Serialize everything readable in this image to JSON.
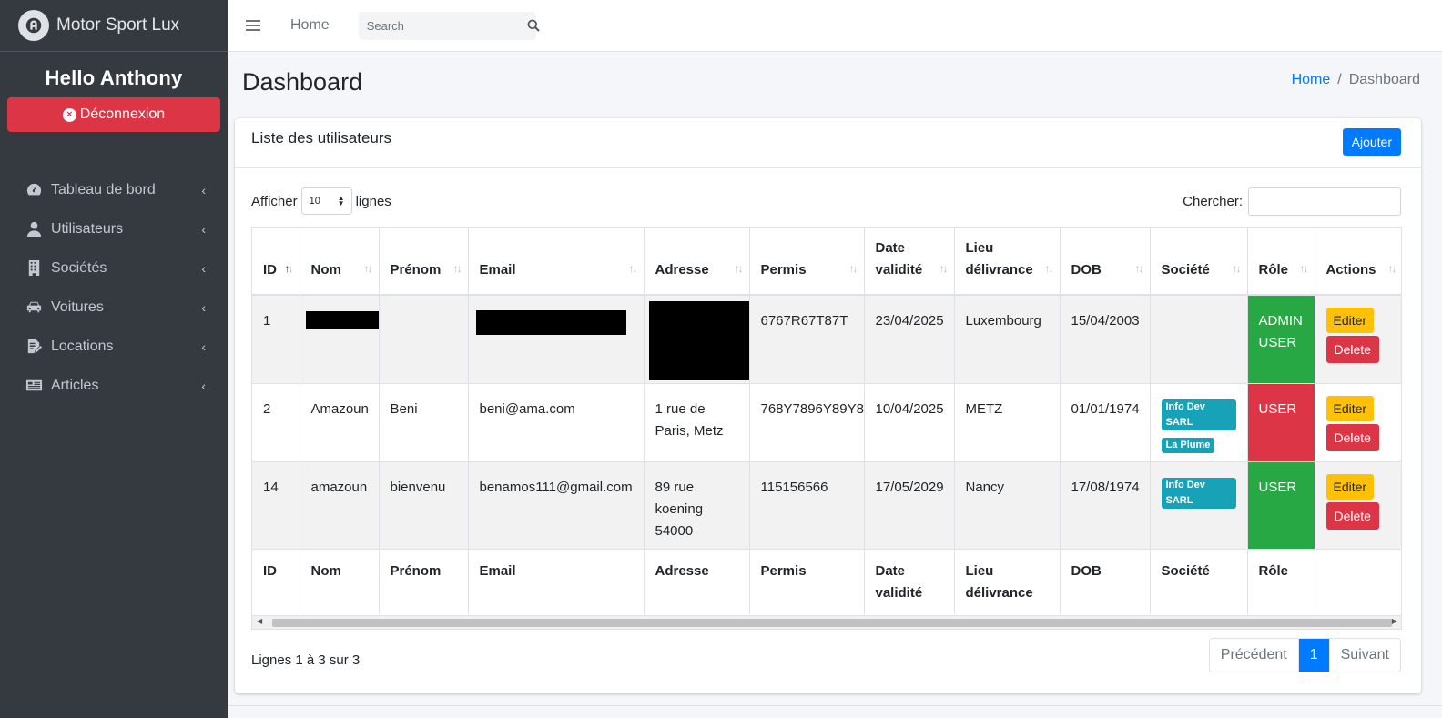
{
  "brand": {
    "name": "Motor Sport Lux"
  },
  "user": {
    "greeting": "Hello Anthony",
    "logout_label": "Déconnexion"
  },
  "sidebar": {
    "items": [
      {
        "label": "Tableau de bord",
        "icon": "speedometer-icon"
      },
      {
        "label": "Utilisateurs",
        "icon": "user-icon"
      },
      {
        "label": "Sociétés",
        "icon": "building-icon"
      },
      {
        "label": "Voitures",
        "icon": "car-icon"
      },
      {
        "label": "Locations",
        "icon": "contract-icon"
      },
      {
        "label": "Articles",
        "icon": "newspaper-icon"
      }
    ]
  },
  "topbar": {
    "home": "Home",
    "search_placeholder": "Search"
  },
  "header": {
    "title": "Dashboard",
    "breadcrumb_home": "Home",
    "breadcrumb_current": "Dashboard"
  },
  "card": {
    "title": "Liste des utilisateurs",
    "add_label": "Ajouter"
  },
  "controls": {
    "show_prefix": "Afficher",
    "show_value": "10",
    "show_suffix": "lignes",
    "search_label": "Chercher:"
  },
  "table": {
    "headers": [
      [
        "ID"
      ],
      [
        "Nom"
      ],
      [
        "Prénom"
      ],
      [
        "Email"
      ],
      [
        "Adresse"
      ],
      [
        "Permis"
      ],
      [
        "Date",
        "validité"
      ],
      [
        "Lieu",
        "délivrance"
      ],
      [
        "DOB"
      ],
      [
        "Société"
      ],
      [
        "Rôle"
      ],
      [
        "Actions"
      ]
    ],
    "rows": [
      {
        "id": "1",
        "nom": "",
        "prenom": "",
        "email": "",
        "adresse": [],
        "permis": "6767R67T87T",
        "date_validite": "23/04/2025",
        "lieu": "Luxembourg",
        "dob": "15/04/2003",
        "societes": [],
        "role": [
          "ADMIN",
          "USER"
        ]
      },
      {
        "id": "2",
        "nom": "Amazoun",
        "prenom": "Beni",
        "email": "beni@ama.com",
        "adresse": [
          "1 rue de",
          "Paris, Metz"
        ],
        "permis": "768Y7896Y89Y8",
        "date_validite": "10/04/2025",
        "lieu": "METZ",
        "dob": "01/01/1974",
        "societes": [
          "Info Dev SARL",
          "La Plume"
        ],
        "role": [
          "USER"
        ]
      },
      {
        "id": "14",
        "nom": "amazoun",
        "prenom": "bienvenu",
        "email": "benamos111@gmail.com",
        "adresse": [
          "89 rue",
          "koening",
          "54000"
        ],
        "permis": "115156566",
        "date_validite": "17/05/2029",
        "lieu": "Nancy",
        "dob": "17/08/1974",
        "societes": [
          "Info Dev SARL"
        ],
        "role": [
          "USER"
        ]
      }
    ],
    "footer": [
      [
        "ID"
      ],
      [
        "Nom"
      ],
      [
        "Prénom"
      ],
      [
        "Email"
      ],
      [
        "Adresse"
      ],
      [
        "Permis"
      ],
      [
        "Date",
        "validité"
      ],
      [
        "Lieu",
        "délivrance"
      ],
      [
        "DOB"
      ],
      [
        "Société"
      ],
      [
        "Rôle"
      ]
    ],
    "edit_label": "Editer",
    "delete_label": "Delete"
  },
  "pagination": {
    "info": "Lignes 1 à 3 sur 3",
    "prev": "Précédent",
    "current": "1",
    "next": "Suivant"
  },
  "colors": {
    "primary": "#007bff",
    "danger": "#dc3545",
    "success": "#28a745",
    "warning": "#ffc107",
    "info": "#17a2b8",
    "sidebar": "#343a40"
  }
}
